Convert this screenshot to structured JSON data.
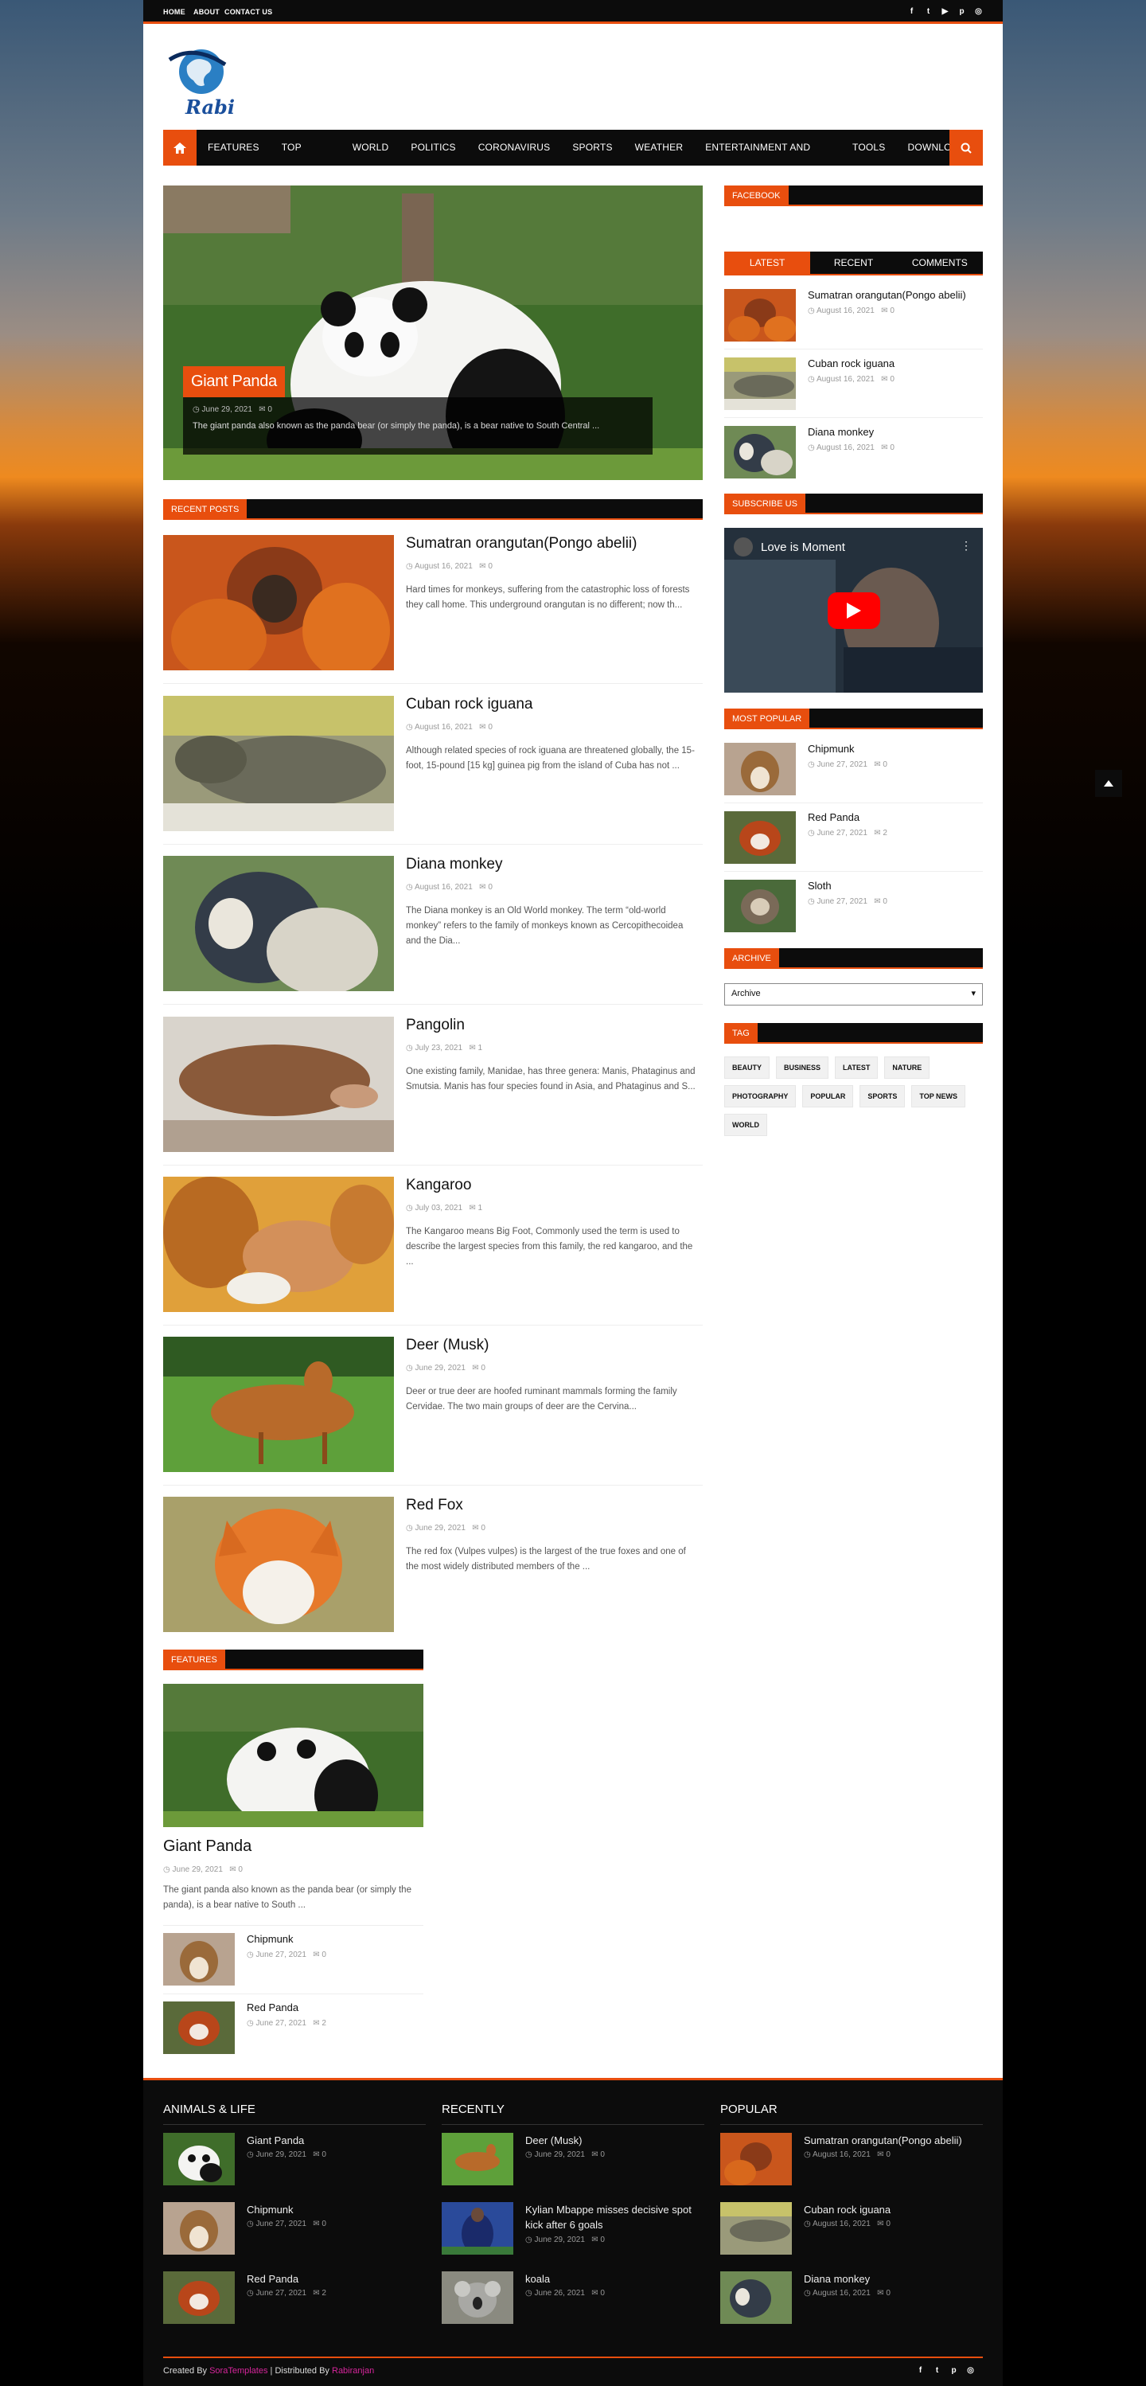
{
  "topbar": {
    "links": [
      "HOME",
      "ABOUT",
      "CONTACT US"
    ],
    "social_icons": [
      "facebook-icon",
      "twitter-icon",
      "youtube-icon",
      "pinterest-icon",
      "instagram-icon"
    ]
  },
  "logo": {
    "text": "Rabi"
  },
  "nav": {
    "items": [
      "FEATURES",
      "TOP NEWS",
      "WORLD",
      "POLITICS",
      "CORONAVIRUS",
      "SPORTS",
      "WEATHER",
      "ENTERTAINMENT AND ARTS",
      "TOOLS",
      "DOWNLOADS"
    ]
  },
  "hero": {
    "title": "Giant Panda",
    "date": "June 29, 2021",
    "comments": "0",
    "excerpt": "The giant panda also known as the panda bear (or simply the panda), is a bear native to South Central ..."
  },
  "recent": {
    "title": "RECENT POSTS",
    "posts": [
      {
        "title": "Sumatran orangutan(Pongo abelii)",
        "date": "August 16, 2021",
        "comments": "0",
        "excerpt": "Hard times for monkeys, suffering from the catastrophic loss of forests they call home. This underground orangutan is no different; now th..."
      },
      {
        "title": "Cuban rock iguana",
        "date": "August 16, 2021",
        "comments": "0",
        "excerpt": "Although related species of rock iguana are threatened globally, the 15-foot, 15-pound [15 kg] guinea pig from the island of Cuba has not ..."
      },
      {
        "title": "Diana monkey",
        "date": "August 16, 2021",
        "comments": "0",
        "excerpt": "The Diana monkey is an Old World monkey. The term “old-world monkey” refers to the family of monkeys known as Cercopithecoidea and the Dia..."
      },
      {
        "title": "Pangolin",
        "date": "July 23, 2021",
        "comments": "1",
        "excerpt": "One existing family, Manidae, has three genera: Manis, Phataginus and Smutsia. Manis has four species found in Asia, and Phataginus and S..."
      },
      {
        "title": "Kangaroo",
        "date": "July 03, 2021",
        "comments": "1",
        "excerpt": "The Kangaroo means Big Foot, Commonly used the term is used to describe the largest species from this family, the red kangaroo, and the ..."
      },
      {
        "title": "Deer (Musk)",
        "date": "June 29, 2021",
        "comments": "0",
        "excerpt": "Deer or true deer are hoofed ruminant mammals forming the family Cervidae. The two main groups of deer are the Cervina..."
      },
      {
        "title": "Red Fox",
        "date": "June 29, 2021",
        "comments": "0",
        "excerpt": "The red fox (Vulpes vulpes) is the largest of the true foxes and one of the most widely distributed members of the ..."
      }
    ]
  },
  "features": {
    "title": "FEATURES",
    "main": {
      "title": "Giant Panda",
      "date": "June 29, 2021",
      "comments": "0",
      "excerpt": "The giant panda also known as the panda bear (or simply the panda), is a bear native to South ..."
    },
    "items": [
      {
        "title": "Chipmunk",
        "date": "June 27, 2021",
        "comments": "0"
      },
      {
        "title": "Red Panda",
        "date": "June 27, 2021",
        "comments": "2"
      }
    ]
  },
  "sidebar": {
    "facebook_title": "FACEBOOK",
    "tabs": [
      "LATEST",
      "RECENT",
      "COMMENTS"
    ],
    "latest": [
      {
        "title": "Sumatran orangutan(Pongo abelii)",
        "date": "August 16, 2021",
        "comments": "0"
      },
      {
        "title": "Cuban rock iguana",
        "date": "August 16, 2021",
        "comments": "0"
      },
      {
        "title": "Diana monkey",
        "date": "August 16, 2021",
        "comments": "0"
      }
    ],
    "subscribe_title": "SUBSCRIBE US",
    "video_title": "Love is Moment",
    "popular_title": "MOST POPULAR",
    "popular": [
      {
        "title": "Chipmunk",
        "date": "June 27, 2021",
        "comments": "0"
      },
      {
        "title": "Red Panda",
        "date": "June 27, 2021",
        "comments": "2"
      },
      {
        "title": "Sloth",
        "date": "June 27, 2021",
        "comments": "0"
      }
    ],
    "archive_title": "ARCHIVE",
    "archive_value": "Archive",
    "tag_title": "TAG",
    "tags": [
      "BEAUTY",
      "BUSINESS",
      "LATEST",
      "NATURE",
      "PHOTOGRAPHY",
      "POPULAR",
      "SPORTS",
      "TOP NEWS",
      "WORLD"
    ]
  },
  "footer": {
    "col1": {
      "title": "ANIMALS & LIFE",
      "items": [
        {
          "title": "Giant Panda",
          "date": "June 29, 2021",
          "comments": "0"
        },
        {
          "title": "Chipmunk",
          "date": "June 27, 2021",
          "comments": "0"
        },
        {
          "title": "Red Panda",
          "date": "June 27, 2021",
          "comments": "2"
        }
      ]
    },
    "col2": {
      "title": "RECENTLY",
      "items": [
        {
          "title": "Deer (Musk)",
          "date": "June 29, 2021",
          "comments": "0"
        },
        {
          "title": "Kylian Mbappe misses decisive spot kick after 6 goals",
          "date": "June 29, 2021",
          "comments": "0"
        },
        {
          "title": "koala",
          "date": "June 26, 2021",
          "comments": "0"
        }
      ]
    },
    "col3": {
      "title": "POPULAR",
      "items": [
        {
          "title": "Sumatran orangutan(Pongo abelii)",
          "date": "August 16, 2021",
          "comments": "0"
        },
        {
          "title": "Cuban rock iguana",
          "date": "August 16, 2021",
          "comments": "0"
        },
        {
          "title": "Diana monkey",
          "date": "August 16, 2021",
          "comments": "0"
        }
      ]
    },
    "credit": {
      "created_by": "Created By",
      "sora": "SoraTemplates",
      "divider": "|",
      "distributed": "Distributed By",
      "author": "Rabiranjan"
    }
  },
  "colors": {
    "accent": "#e84e0e",
    "dark": "#0c0c0c",
    "pink": "#d6259b"
  }
}
